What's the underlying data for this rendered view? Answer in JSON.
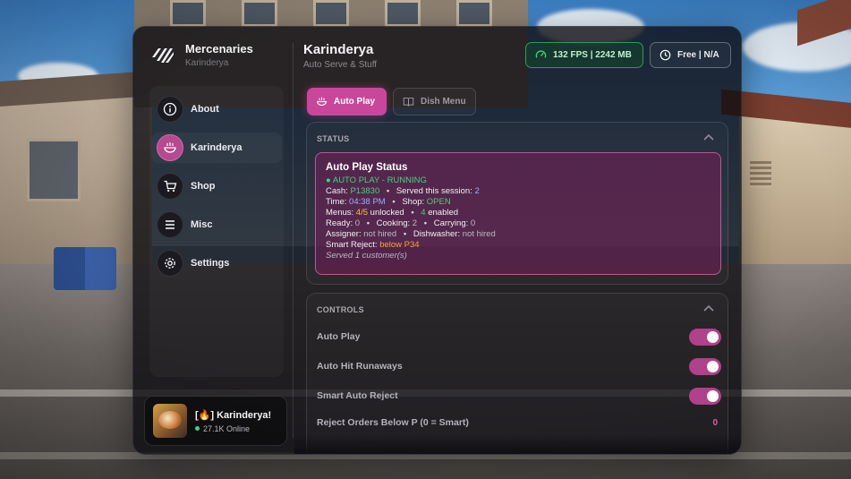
{
  "brand": {
    "title": "Mercenaries",
    "subtitle": "Karinderya"
  },
  "header": {
    "title": "Karinderya",
    "subtitle": "Auto Serve & Stuff"
  },
  "badges": {
    "fps": "132 FPS | 2242 MB",
    "server": "Free | N/A"
  },
  "sidebar": {
    "items": [
      {
        "label": "About",
        "icon": "info-icon",
        "active": false
      },
      {
        "label": "Karinderya",
        "icon": "bowl-icon",
        "active": true
      },
      {
        "label": "Shop",
        "icon": "cart-icon",
        "active": false
      },
      {
        "label": "Misc",
        "icon": "menu-icon",
        "active": false
      },
      {
        "label": "Settings",
        "icon": "gear-icon",
        "active": false
      }
    ]
  },
  "profile": {
    "title": "[🔥] Karinderya!",
    "online": "27.1K Online"
  },
  "tabs": [
    {
      "label": "Auto Play",
      "icon": "bowl-icon",
      "active": true
    },
    {
      "label": "Dish Menu",
      "icon": "book-icon",
      "active": false
    }
  ],
  "status_section": {
    "header": "STATUS",
    "card": {
      "title": "Auto Play Status",
      "state": "● AUTO PLAY - RUNNING",
      "cash_label": "Cash:",
      "cash_value": "P13830",
      "served_label": "Served this session:",
      "served_value": "2",
      "time_label": "Time:",
      "time_value": "04:38 PM",
      "shop_label": "Shop:",
      "shop_value": "OPEN",
      "menus_label": "Menus:",
      "menus_value": "4/5",
      "menus_unlocked": "unlocked",
      "enabled_value": "4",
      "enabled_label": "enabled",
      "ready_label": "Ready:",
      "ready_value": "0",
      "cooking_label": "Cooking:",
      "cooking_value": "2",
      "carrying_label": "Carrying:",
      "carrying_value": "0",
      "assigner_label": "Assigner:",
      "assigner_value": "not hired",
      "dishwasher_label": "Dishwasher:",
      "dishwasher_value": "not hired",
      "smart_label": "Smart Reject:",
      "smart_value": "below P34",
      "footer": "Served 1 customer(s)",
      "separator": "•"
    }
  },
  "controls_section": {
    "header": "CONTROLS",
    "rows": [
      {
        "label": "Auto Play",
        "type": "toggle",
        "on": true
      },
      {
        "label": "Auto Hit Runaways",
        "type": "toggle",
        "on": true
      },
      {
        "label": "Smart Auto Reject",
        "type": "toggle",
        "on": true
      },
      {
        "label": "Reject Orders Below P (0 = Smart)",
        "type": "value",
        "value": "0"
      }
    ]
  },
  "colors": {
    "accent": "#c9479a",
    "status_green": "#43d17e",
    "highlight_yellow": "#f2c040",
    "time_blue": "#8fb6ff"
  }
}
